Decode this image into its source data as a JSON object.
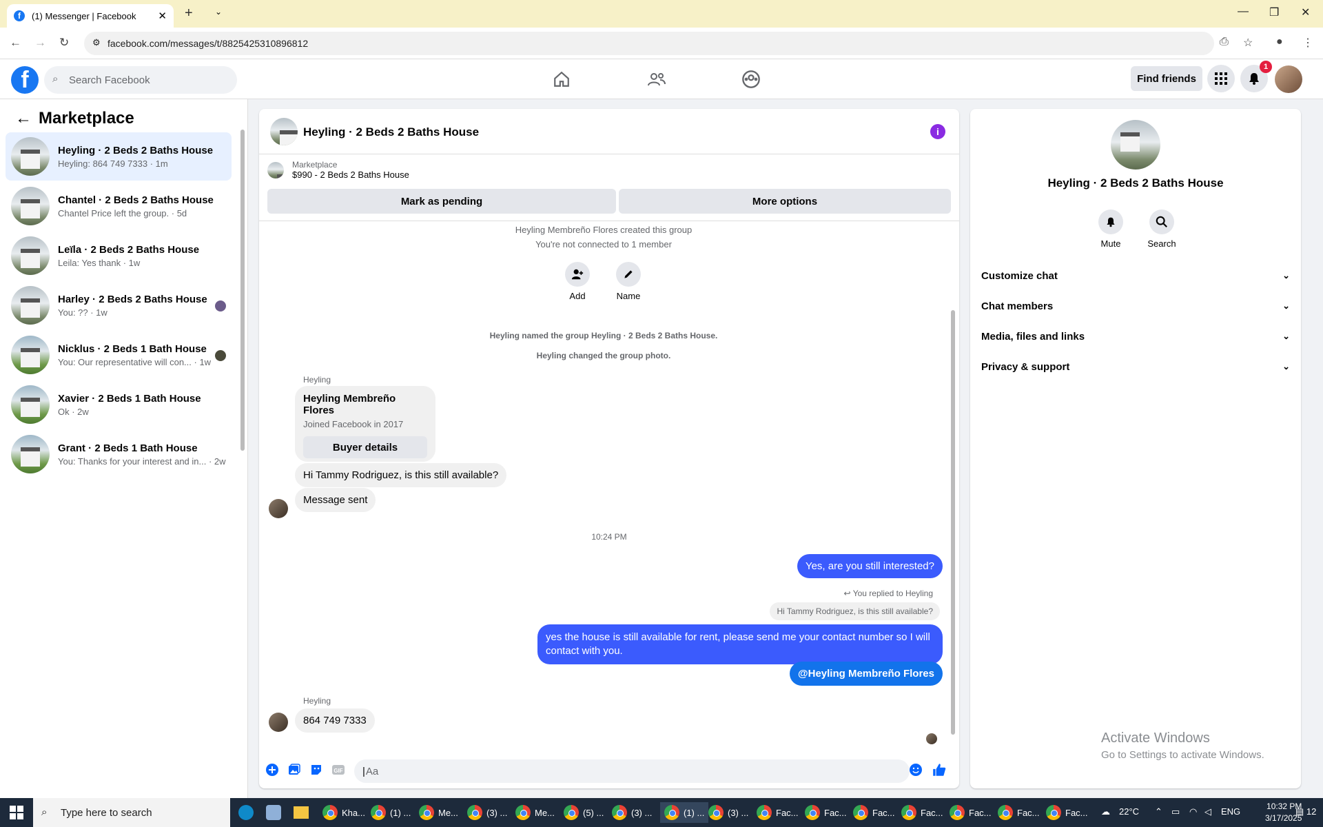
{
  "browser": {
    "tab_title": "(1) Messenger | Facebook",
    "url": "facebook.com/messages/t/8825425310896812"
  },
  "facebook": {
    "search_placeholder": "Search Facebook",
    "find_friends": "Find friends",
    "notification_count": "1"
  },
  "sidebar": {
    "title": "Marketplace",
    "conversations": [
      {
        "title": "Heyling · 2 Beds 2 Baths House",
        "sub": "Heyling: 864 749 7333 · 1m"
      },
      {
        "title": "Chantel · 2 Beds 2 Baths House",
        "sub": "Chantel Price left the group. · 5d"
      },
      {
        "title": "Leïla · 2 Beds 2 Baths House",
        "sub": "Leila: Yes thank · 1w"
      },
      {
        "title": "Harley · 2 Beds 2 Baths House",
        "sub": "You: ?? · 1w"
      },
      {
        "title": "Nicklus · 2 Beds 1 Bath House",
        "sub": "You: Our representative will con... · 1w"
      },
      {
        "title": "Xavier · 2 Beds 1 Bath House",
        "sub": "Ok · 2w"
      },
      {
        "title": "Grant · 2 Beds 1 Bath House",
        "sub": "You: Thanks for your interest and in... · 2w"
      }
    ]
  },
  "chat": {
    "title": "Heyling · 2 Beds 2 Baths House",
    "marketplace_label": "Marketplace",
    "listing": "$990 - 2 Beds 2 Baths House",
    "mark_pending": "Mark as pending",
    "more_options": "More options",
    "created": "Heyling Membreño Flores created this group",
    "not_connected": "You're not connected to 1 member",
    "add_label": "Add",
    "name_label": "Name",
    "named_group": "Heyling named the group Heyling · 2 Beds 2 Baths House.",
    "changed_photo": "Heyling changed the group photo.",
    "sender1": "Heyling",
    "card_name": "Heyling Membreño Flores",
    "card_joined": "Joined Facebook in 2017",
    "card_button": "Buyer details",
    "msg1": "Hi Tammy Rodriguez, is this still available?",
    "msg2": "Message sent",
    "time": "10:24 PM",
    "out1": "Yes, are you still interested?",
    "replied": "You replied to Heyling",
    "quote": "Hi Tammy Rodriguez, is this still available?",
    "out2_line1": "yes the house is still available for rent, please send me your contact number so I will",
    "out2_line2": "contact with you.",
    "out3": "@Heyling Membreño Flores",
    "sender2": "Heyling",
    "msg3": "864 749 7333",
    "composer_placeholder": "Aa"
  },
  "info_panel": {
    "title": "Heyling · 2 Beds 2 Baths House",
    "mute": "Mute",
    "search": "Search",
    "rows": [
      "Customize chat",
      "Chat members",
      "Media, files and links",
      "Privacy & support"
    ]
  },
  "watermark": {
    "line1": "Activate Windows",
    "line2": "Go to Settings to activate Windows."
  },
  "taskbar": {
    "search": "Type here to search",
    "apps": [
      "Kha...",
      "(1) ...",
      "Me...",
      "(3) ...",
      "Me...",
      "(5) ...",
      "(3) ...",
      "(1) ...",
      "(3) ...",
      "Fac...",
      "Fac...",
      "Fac...",
      "Fac...",
      "Fac...",
      "Fac...",
      "Fac..."
    ],
    "temp": "22°C",
    "lang": "ENG",
    "time": "10:32 PM",
    "date": "3/17/2025",
    "notif_count": "12"
  }
}
